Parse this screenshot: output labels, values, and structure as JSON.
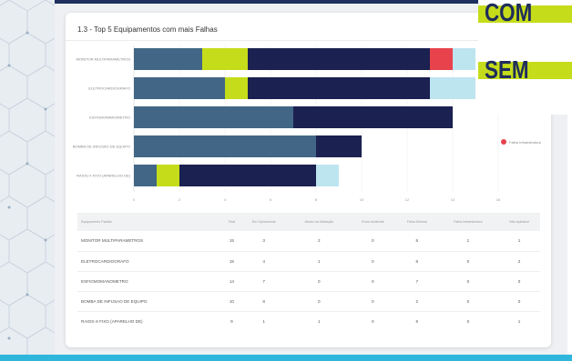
{
  "card": {
    "title": "1.3 - Top 5 Equipamentos com mais Falhas",
    "legend_visible": "Falha Infraestrutura"
  },
  "overlay": {
    "line1": "COM",
    "line2": "SEM",
    "highlight_color": "#c5dc1a",
    "text_color": "#1f2d5c"
  },
  "chart_data": {
    "type": "bar",
    "orientation": "horizontal",
    "stacked": true,
    "title": "1.3 - Top 5 Equipamentos com mais Falhas",
    "categories": [
      "MONITOR MULTIPARAMETROS",
      "ELETROCARDIOGRAFO",
      "ESFIGMOMANOMETRO",
      "BOMBA DE INFUSAO DE EQUIPO",
      "RAIOS-X FIXO (APARELHO DE)"
    ],
    "series": [
      {
        "name": "Em Operacional",
        "color": "#426786",
        "values": [
          3,
          4,
          7,
          8,
          1
        ]
      },
      {
        "name": "Abuso na Utilização",
        "color": "#c5dc1a",
        "values": [
          2,
          1,
          0,
          0,
          1
        ]
      },
      {
        "name": "Erros Acidental",
        "color": "#2a8b4c",
        "values": [
          0,
          0,
          0,
          0,
          0
        ]
      },
      {
        "name": "Falha Mínima",
        "color": "#1b2150",
        "values": [
          8,
          8,
          7,
          2,
          6
        ]
      },
      {
        "name": "Falha Infraestrutura",
        "color": "#e8424c",
        "values": [
          1,
          0,
          0,
          0,
          0
        ]
      },
      {
        "name": "Não Aplicável",
        "color": "#bde5f0",
        "values": [
          1,
          2,
          0,
          0,
          1
        ]
      }
    ],
    "x_ticks": [
      0,
      2,
      4,
      6,
      8,
      10,
      12,
      14,
      16
    ],
    "xlim": [
      0,
      16
    ],
    "grid": "vertical"
  },
  "table": {
    "headers": [
      "Equipamento Padrão",
      "Total",
      "Em Operacional",
      "Abuso na Utilização",
      "Erros Acidental",
      "Falha Mínima",
      "Falha Infraestrutura",
      "Não Aplicável"
    ],
    "rows": [
      [
        "MONITOR MULTIPARAMETROS",
        "15",
        "3",
        "2",
        "0",
        "8",
        "1",
        "1"
      ],
      [
        "ELETROCARDIOGRAFO",
        "15",
        "4",
        "1",
        "0",
        "8",
        "0",
        "2"
      ],
      [
        "ESFIGMOMANOMETRO",
        "14",
        "7",
        "0",
        "0",
        "7",
        "0",
        "0"
      ],
      [
        "BOMBA DE INFUSAO DE EQUIPO",
        "10",
        "8",
        "0",
        "0",
        "2",
        "0",
        "0"
      ],
      [
        "RAIOS-X FIXO (APARELHO DE)",
        "9",
        "1",
        "1",
        "0",
        "6",
        "0",
        "1"
      ]
    ]
  }
}
